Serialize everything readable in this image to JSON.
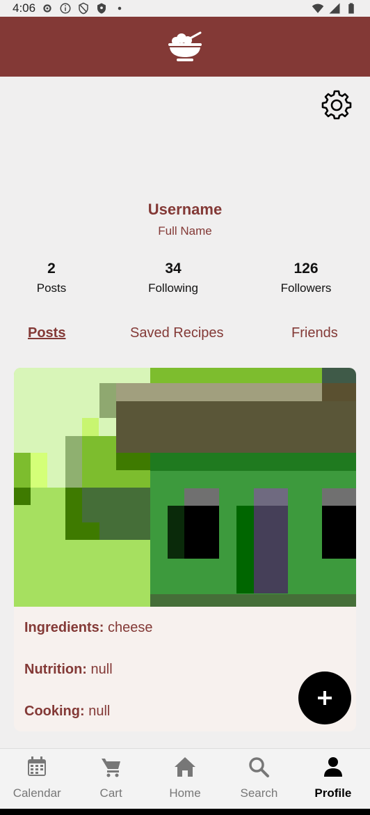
{
  "status_bar": {
    "time": "4:06",
    "left_icons": [
      "gear-icon",
      "info-icon",
      "shield-icon",
      "shield-filled-icon",
      "dot-icon"
    ],
    "right_icons": [
      "wifi-icon",
      "signal-icon",
      "battery-icon"
    ]
  },
  "header": {
    "logo_icon": "bowl-icon",
    "color": "#833936"
  },
  "profile": {
    "username": "Username",
    "full_name": "Full Name",
    "stats": [
      {
        "value": "2",
        "label": "Posts"
      },
      {
        "value": "34",
        "label": "Following"
      },
      {
        "value": "126",
        "label": "Followers"
      }
    ]
  },
  "tabs": [
    {
      "label": "Posts",
      "active": true
    },
    {
      "label": "Saved Recipes",
      "active": false
    },
    {
      "label": "Friends",
      "active": false
    }
  ],
  "post": {
    "ingredients_label": "Ingredients:",
    "ingredients_value": " cheese",
    "nutrition_label": "Nutrition:",
    "nutrition_value": " null",
    "cooking_label": "Cooking:",
    "cooking_value": " null"
  },
  "fab": {
    "icon": "plus-icon"
  },
  "nav": {
    "items": [
      {
        "label": "Calendar",
        "icon": "calendar-icon",
        "active": false
      },
      {
        "label": "Cart",
        "icon": "cart-icon",
        "active": false
      },
      {
        "label": "Home",
        "icon": "home-icon",
        "active": false
      },
      {
        "label": "Search",
        "icon": "search-icon",
        "active": false
      },
      {
        "label": "Profile",
        "icon": "person-icon",
        "active": true
      }
    ]
  },
  "colors": {
    "brand": "#833936",
    "background": "#f0efef",
    "card": "#f7f1ee"
  }
}
